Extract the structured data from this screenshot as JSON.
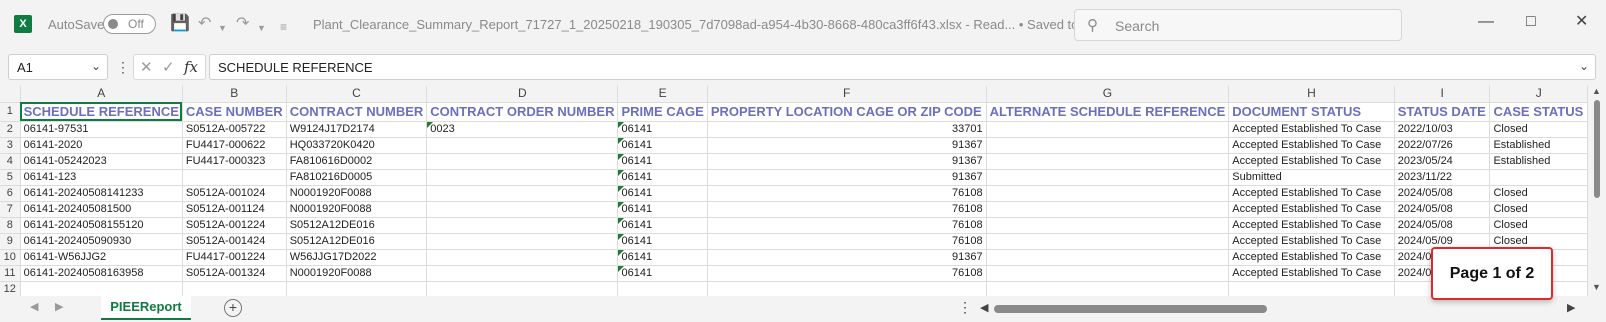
{
  "titlebar": {
    "autosave_label": "AutoSave",
    "autosave_state": "Off",
    "document_title": "Plant_Clearance_Summary_Report_71727_1_20250218_190305_7d7098ad-a954-4b30-8668-480ca3ff6f43.xlsx  -  Read...  •  Saved to this PC ∨",
    "search_placeholder": "Search"
  },
  "formula_bar": {
    "name_box": "A1",
    "content": "SCHEDULE REFERENCE"
  },
  "grid": {
    "columns": [
      "A",
      "B",
      "C",
      "D",
      "E",
      "F",
      "G",
      "H",
      "I",
      "J"
    ],
    "rows": [
      "1",
      "2",
      "3",
      "4",
      "5",
      "6",
      "7",
      "8",
      "9",
      "10",
      "11",
      "12"
    ],
    "headers": [
      "SCHEDULE REFERENCE",
      "CASE NUMBER",
      "CONTRACT NUMBER",
      "CONTRACT ORDER NUMBER",
      "PRIME CAGE",
      "PROPERTY LOCATION CAGE OR ZIP CODE",
      "ALTERNATE SCHEDULE REFERENCE",
      "DOCUMENT STATUS",
      "STATUS DATE",
      "CASE STATUS"
    ],
    "data": [
      [
        "06141-97531",
        "S0512A-005722",
        "W9124J17D2174",
        "0023",
        "06141",
        "33701",
        "",
        "Accepted Established To Case",
        "2022/10/03",
        "Closed"
      ],
      [
        "06141-2020",
        "FU4417-000622",
        "HQ033720K0420",
        "",
        "06141",
        "91367",
        "",
        "Accepted Established To Case",
        "2022/07/26",
        "Established"
      ],
      [
        "06141-05242023",
        "FU4417-000323",
        "FA810616D0002",
        "",
        "06141",
        "91367",
        "",
        "Accepted Established To Case",
        "2023/05/24",
        "Established"
      ],
      [
        "06141-123",
        "",
        "FA810216D0005",
        "",
        "06141",
        "91367",
        "",
        "Submitted",
        "2023/11/22",
        ""
      ],
      [
        "06141-20240508141233",
        "S0512A-001024",
        "N0001920F0088",
        "",
        "06141",
        "76108",
        "",
        "Accepted Established To Case",
        "2024/05/08",
        "Closed"
      ],
      [
        "06141-202405081500",
        "S0512A-001124",
        "N0001920F0088",
        "",
        "06141",
        "76108",
        "",
        "Accepted Established To Case",
        "2024/05/08",
        "Closed"
      ],
      [
        "06141-20240508155120",
        "S0512A-001224",
        "S0512A12DE016",
        "",
        "06141",
        "76108",
        "",
        "Accepted Established To Case",
        "2024/05/08",
        "Closed"
      ],
      [
        "06141-202405090930",
        "S0512A-001424",
        "S0512A12DE016",
        "",
        "06141",
        "76108",
        "",
        "Accepted Established To Case",
        "2024/05/09",
        "Closed"
      ],
      [
        "06141-W56JJG2",
        "FU4417-001224",
        "W56JJG17D2022",
        "",
        "06141",
        "91367",
        "",
        "Accepted Established To Case",
        "2024/05",
        ""
      ],
      [
        "06141-20240508163958",
        "S0512A-001324",
        "N0001920F0088",
        "",
        "06141",
        "76108",
        "",
        "Accepted Established To Case",
        "2024/05",
        ""
      ]
    ]
  },
  "sheet_tabs": [
    "PIEEReport"
  ],
  "page_badge": "Page 1 of 2"
}
